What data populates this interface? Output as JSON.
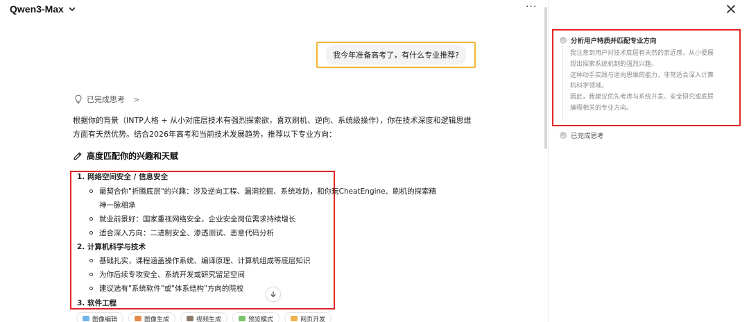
{
  "header": {
    "model_name": "Qwen3-Max",
    "more_label": "···"
  },
  "user_message": "我今年准备高考了，有什么专业推荐?",
  "thinking_toggle": {
    "label": "已完成思考",
    "arrow": ">"
  },
  "answer": {
    "intro": "根据你的背景（INTP人格 + 从小对底层技术有强烈探索欲，喜欢刷机、逆向、系统级操作），你在技术深度和逻辑思维方面有天然优势。结合2026年高考和当前技术发展趋势，推荐以下专业方向：",
    "section_heading": "高度匹配你的兴趣和天赋",
    "items": [
      {
        "title": "1. 网络空间安全 / 信息安全",
        "subs": [
          "最契合你\"折腾底层\"的兴趣：涉及逆向工程、漏洞挖掘、系统攻防，和你玩CheatEngine、刷机的探索精",
          "神一脉相承",
          "就业前景好：国家重视网络安全，企业安全岗位需求持续增长",
          "适合深入方向：二进制安全、渗透测试、恶意代码分析"
        ]
      },
      {
        "title": "2. 计算机科学与技术",
        "subs": [
          "基础扎实，课程涵盖操作系统、编译原理、计算机组成等底层知识",
          "为你后续专攻安全、系统开发或研究留足空间",
          "建议选有\"系统软件\"或\"体系结构\"方向的院校"
        ]
      },
      {
        "title": "3. 软件工程",
        "subs": []
      }
    ]
  },
  "chips": [
    {
      "label": "图像编辑",
      "color": "#6fb3e8"
    },
    {
      "label": "图像生成",
      "color": "#e58b4a"
    },
    {
      "label": "视频生成",
      "color": "#8c7b6a"
    },
    {
      "label": "预览模式",
      "color": "#7ac36a"
    },
    {
      "label": "网页开发",
      "color": "#f0b24a"
    }
  ],
  "side_panel": {
    "step1_title": "分析用户特质并匹配专业方向",
    "step1_lines": [
      "我注意到用户对技术底层有天然的亲近感，从小便展",
      "现出探索系统机制的强烈兴趣。",
      "这种动手实践与逆向思维的能力，非常适合深入计算",
      "机科学领域。",
      "因此，我建议优先考虑与系统开发、安全研究或底层",
      "编程相关的专业方向。"
    ],
    "step2_title": "已完成思考"
  }
}
